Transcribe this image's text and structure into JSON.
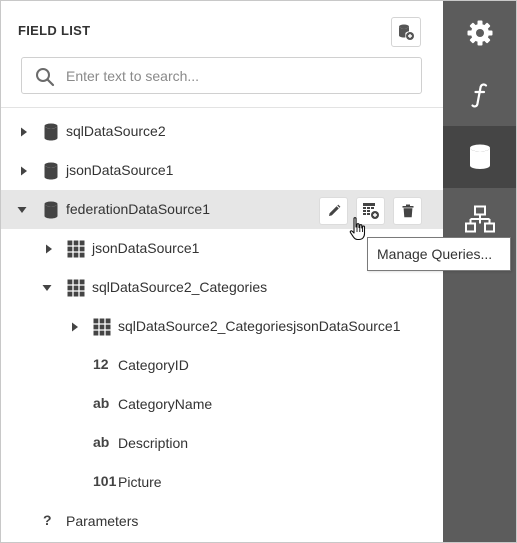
{
  "panel": {
    "title": "FIELD LIST",
    "search": {
      "placeholder": "Enter text to search...",
      "value": ""
    }
  },
  "tree": {
    "sql_ds2": "sqlDataSource2",
    "json_ds1": "jsonDataSource1",
    "federation": "federationDataSource1",
    "fed_json_ds1": "jsonDataSource1",
    "categories": "sqlDataSource2_Categories",
    "categories_join": "sqlDataSource2_CategoriesjsonDataSource1",
    "fields": [
      {
        "type_glyph": "12",
        "label": "CategoryID"
      },
      {
        "type_glyph": "ab",
        "label": "CategoryName"
      },
      {
        "type_glyph": "ab",
        "label": "Description"
      },
      {
        "type_glyph": "101",
        "label": "Picture"
      }
    ],
    "parameters_glyph": "?",
    "parameters": "Parameters"
  },
  "tooltip": "Manage Queries...",
  "tabs": [
    {
      "icon": "gear-icon",
      "active": false
    },
    {
      "icon": "function-icon",
      "active": false
    },
    {
      "icon": "database-icon",
      "active": true
    },
    {
      "icon": "hierarchy-icon",
      "active": false
    }
  ],
  "colors": {
    "tabbar_bg": "#5c5c5c",
    "tab_active_bg": "#454545",
    "selected_row_bg": "#e6e6e6",
    "icon_dark": "#444444"
  }
}
